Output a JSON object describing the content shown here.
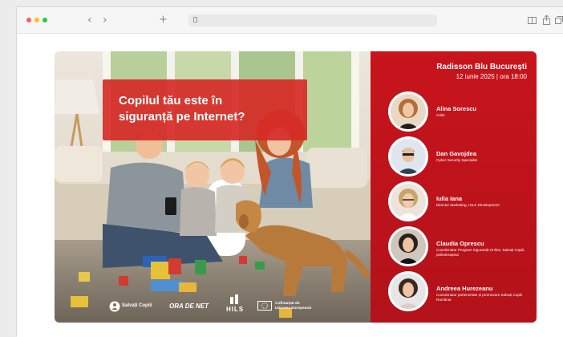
{
  "browser": {
    "dots": [
      "#fc5f57",
      "#fdbc2e",
      "#28c840"
    ],
    "icons": [
      "back-icon",
      "forward-icon",
      "new-tab-icon",
      "lock-icon",
      "reader-icon",
      "share-icon",
      "tabs-icon"
    ]
  },
  "banner": {
    "headline": "Copilul tău este în siguranță pe Internet?",
    "venue": "Radisson Blu București",
    "date": "12 iunie 2025 | ora 18:00",
    "accent": "#c8141c",
    "speakers": [
      {
        "name": "Alina Sorescu",
        "role": "Artist"
      },
      {
        "name": "Dan Gavojdea",
        "role": "Cyber Security Specialist"
      },
      {
        "name": "Iulia Iana",
        "role": "Director Marketing, HILS Development"
      },
      {
        "name": "Claudia Oprescu",
        "role": "Coordonator Program Siguranță Online, Salvați Copiii, psihoterapeut"
      },
      {
        "name": "Andreea Hurezeanu",
        "role": "Coordonator parteneriate și promovare Salvați Copiii România"
      }
    ],
    "logos": {
      "salvati": "Salvați Copiii",
      "orade": "ORA DE NET",
      "hils": "HILS",
      "eu_line1": "Cofinanțat de",
      "eu_line2": "Uniunea Europeană"
    }
  }
}
